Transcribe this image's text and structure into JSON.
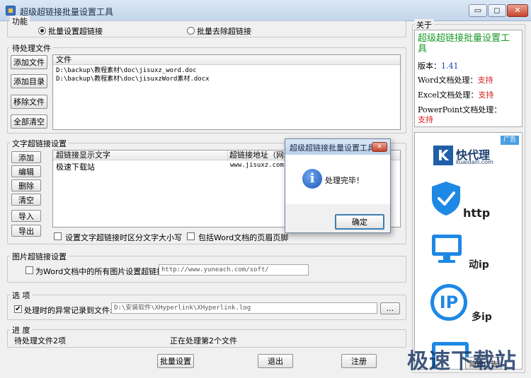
{
  "window": {
    "title": "超级超链接批量设置工具",
    "minimize": "▭",
    "maximize": "◻",
    "close": "✕"
  },
  "function_group": {
    "label": "功能",
    "options": [
      {
        "label": "批量设置超链接",
        "selected": true
      },
      {
        "label": "批量去除超链接",
        "selected": false
      }
    ]
  },
  "pending_group": {
    "label": "待处理文件",
    "buttons": [
      "添加文件",
      "添加目录",
      "移除文件",
      "全部清空"
    ],
    "list_header": "文件",
    "files": [
      "D:\\backup\\教程素材\\doc\\jisuxz_word.doc",
      "D:\\backup\\教程素材\\doc\\jisuxzWord素材.docx"
    ]
  },
  "text_link_group": {
    "label": "文字超链接设置",
    "buttons": [
      "添加",
      "编辑",
      "删除",
      "清空",
      "导入",
      "导出"
    ],
    "columns": [
      "超链接显示文字",
      "超链接地址（网址）"
    ],
    "rows": [
      [
        "极速下载站",
        "www.jisuxz.com"
      ]
    ],
    "checkboxes": [
      {
        "label": "设置文字超链接时区分文字大小写",
        "checked": false
      },
      {
        "label": "包括Word文档的页眉页脚",
        "checked": false
      }
    ]
  },
  "image_link_group": {
    "label": "图片超链接设置",
    "checkbox_label": "为Word文档中的所有图片设置超链接:",
    "checked": false,
    "url_value": "http://www.yuneach.com/soft/"
  },
  "options_group": {
    "label": "选  项",
    "checkbox_label": "处理时的异常记录到文件:",
    "checked": true,
    "path_value": "D:\\安装软件\\XHyperlink\\XHyperlink.log",
    "browse_label": "..."
  },
  "progress_group": {
    "label": "进  度",
    "pending_status": "待处理文件2项",
    "current_status": "正在处理第2个文件"
  },
  "bottom_buttons": {
    "batch": "批量设置",
    "exit": "退出",
    "register": "注册"
  },
  "about": {
    "label": "关于",
    "app_name": "超级超链接批量设置工具",
    "version_label": "版本：",
    "version": "1.41",
    "word_label": "Word文档处理：",
    "excel_label": "Excel文档处理：",
    "ppt_label": "PowerPoint文档处理：",
    "support": "支持",
    "ad_badge": "广告",
    "ad_brand": "快代理",
    "ad_domain": "kuaidaili.com",
    "ad_http": "http",
    "ad_ip": "IP",
    "ad_multi": "多ip",
    "ad_dynamic": "动ip",
    "hide_button": "隐藏广告"
  },
  "dialog": {
    "title": "超级超链接批量设置工具",
    "message": "处理完毕！",
    "ok": "确定",
    "close": "✕"
  },
  "watermark": "极速下载站",
  "colors": {
    "support_red": "#d71a1a",
    "about_green": "#1a9a2a",
    "version_blue": "#1d3fb0",
    "ad_blue": "#1e88e5"
  }
}
